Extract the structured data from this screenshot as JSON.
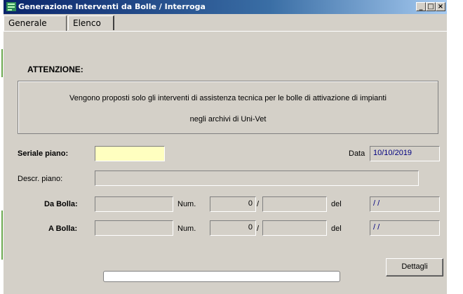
{
  "window": {
    "title": "Generazione Interventi da Bolle / Interroga",
    "controls": {
      "minimize": "_",
      "maximize": "□",
      "close": "×"
    }
  },
  "tabs": [
    {
      "label": "Generale",
      "active": true
    },
    {
      "label": "Elenco",
      "active": false
    }
  ],
  "attention": {
    "title": "ATTENZIONE:",
    "line1": "Vengono proposti solo gli interventi di assistenza tecnica per le bolle di attivazione di impianti",
    "line2": "negli archivi di Uni-Vet"
  },
  "form": {
    "seriale_label": "Seriale piano:",
    "seriale_value": "",
    "data_label": "Data",
    "data_value": "10/10/2019",
    "descr_label": "Descr. piano:",
    "descr_value": "",
    "da_bolla_label": "Da Bolla:",
    "da_bolla_value": "",
    "num_label": "Num.",
    "da_num_value": "0",
    "slash": "/",
    "da_suffix_value": "",
    "del_label": "del",
    "da_del_value": "/ /",
    "a_bolla_label": "A Bolla:",
    "a_bolla_value": "",
    "a_num_value": "0",
    "a_suffix_value": "",
    "a_del_value": "/ /"
  },
  "progress": {
    "value": 0
  },
  "buttons": {
    "dettagli": "Dettagli"
  },
  "colors": {
    "window_bg": "#d4d0c8",
    "titlebar_start": "#0a246a",
    "titlebar_end": "#a6caf0",
    "seriale_bg": "#ffffc0",
    "date_text": "#000080"
  },
  "icons": {
    "app": "application-icon",
    "minimize": "minimize-icon",
    "maximize": "maximize-icon",
    "close": "close-icon"
  }
}
